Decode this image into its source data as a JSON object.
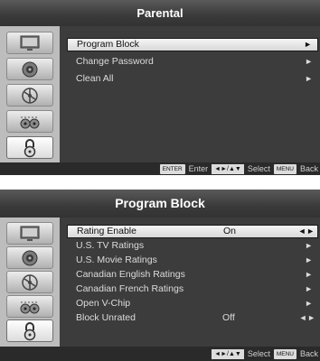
{
  "panel1": {
    "title": "Parental",
    "rows": [
      {
        "label": "Program Block",
        "arrow": "►"
      },
      {
        "label": "Change Password",
        "arrow": "►"
      },
      {
        "label": "Clean All",
        "arrow": "►"
      }
    ],
    "hint": {
      "enter_key": "ENTER",
      "enter_label": "Enter",
      "nav_key": "◄►/▲▼",
      "select_label": "Select",
      "menu_key": "MENU",
      "back_label": "Back"
    }
  },
  "panel2": {
    "title": "Program Block",
    "rows": [
      {
        "label": "Rating Enable",
        "value": "On",
        "arrow": "◄ ►"
      },
      {
        "label": "U.S. TV Ratings",
        "arrow": "►"
      },
      {
        "label": "U.S. Movie Ratings",
        "arrow": "►"
      },
      {
        "label": "Canadian English Ratings",
        "arrow": "►"
      },
      {
        "label": "Canadian French Ratings",
        "arrow": "►"
      },
      {
        "label": "Open V-Chip",
        "arrow": "►"
      },
      {
        "label": "Block Unrated",
        "value": "Off",
        "arrow": "◄ ►"
      }
    ],
    "hint": {
      "nav_key": "◄►/▲▼",
      "select_label": "Select",
      "menu_key": "MENU",
      "back_label": "Back"
    }
  },
  "sidebar_icons": [
    "picture-icon",
    "sound-icon",
    "setup-icon",
    "time-icon",
    "lock-icon"
  ],
  "colors": {
    "content_bg": "#3c3c3c",
    "sidebar_bg": "#bdbdbd",
    "highlight_bg": "#ececec",
    "text": "#dcdcdc"
  }
}
